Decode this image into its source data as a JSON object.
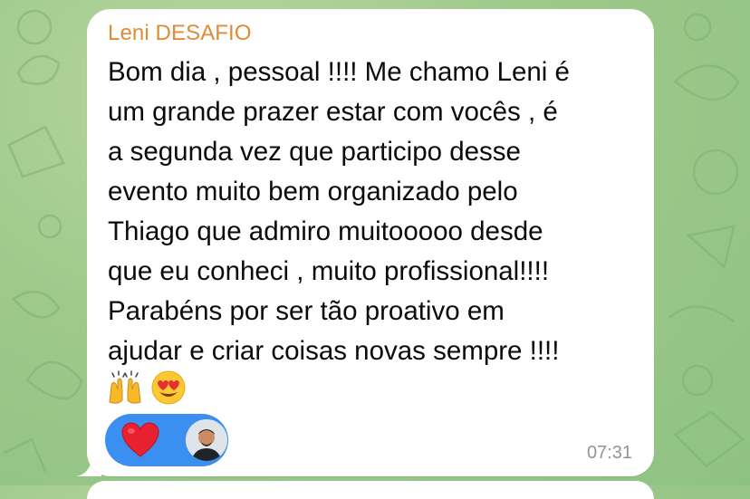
{
  "message": {
    "sender": "Leni DESAFIO",
    "text": "Bom dia , pessoal !!!! Me chamo Leni é\num grande prazer estar com vocês , é\na segunda vez que participo desse\nevento muito bem organizado pelo\nThiago que admiro muitooooo desde\nque eu conheci , muito profissional!!!!\nParabéns por ser tão proativo em\najudar e criar coisas novas sempre !!!!",
    "emojis": [
      "raising-hands-icon",
      "heart-eyes-icon"
    ],
    "time": "07:31"
  },
  "reaction": {
    "icon": "red-heart-icon",
    "reactor": "avatar"
  },
  "colors": {
    "background": "#9ec98b",
    "sender": "#e08a35",
    "reaction_pill": "#3b8ff0",
    "time": "#8e959b"
  }
}
